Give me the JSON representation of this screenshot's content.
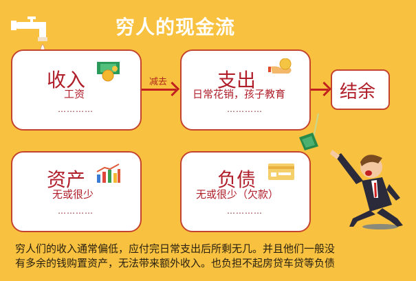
{
  "title": "穷人的现金流",
  "income": {
    "title": "收入",
    "sub": "工资",
    "dots": "…………"
  },
  "arrow_label": "减去",
  "expense": {
    "title": "支出",
    "sub": "日常花销，孩子教育",
    "dots": "…………"
  },
  "balance": {
    "title": "结余"
  },
  "assets": {
    "title": "资产",
    "sub": "无或很少",
    "dots": "…………"
  },
  "liabilities": {
    "title": "负债",
    "sub": "无或很少（欠款）",
    "dots": "…………"
  },
  "description": [
    "穷人们的收入通常偏低，应付完日常支出后所剩无几。并且他们一般没",
    "有多余的钱购置资产，无法带来额外收入。也负担不起房贷车贷等负债"
  ],
  "colors": {
    "background": "#f8c240",
    "accent": "#b01e2a"
  }
}
